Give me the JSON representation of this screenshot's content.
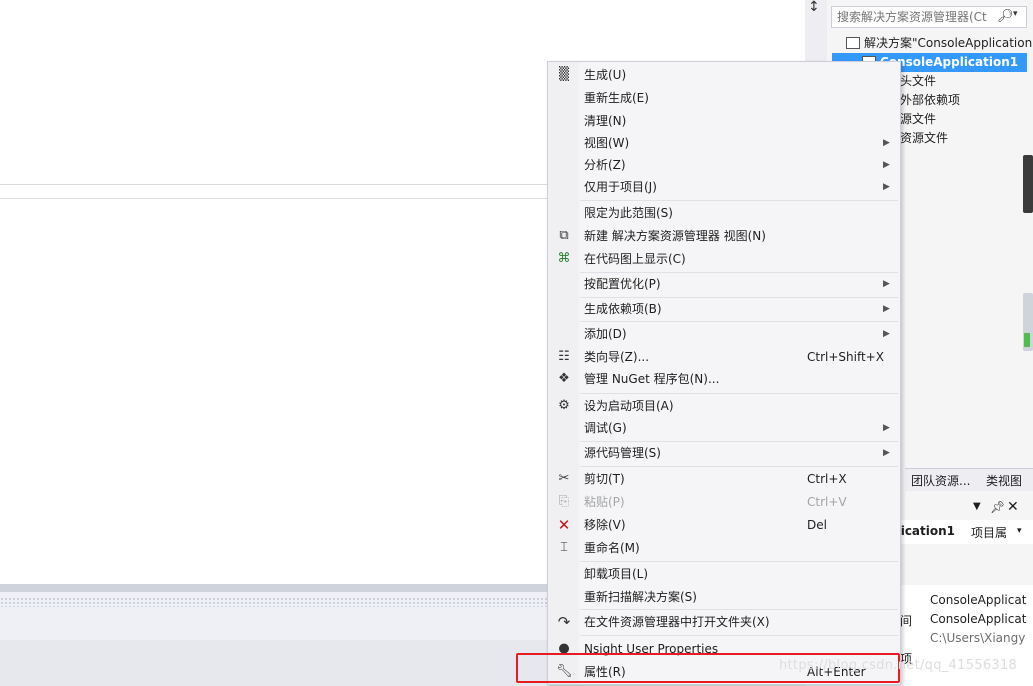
{
  "solution_explorer": {
    "search_placeholder": "搜索解决方案资源管理器(Ctr",
    "tree": [
      {
        "label": "解决方案\"ConsoleApplication",
        "selected": false
      },
      {
        "label": "ConsoleApplication1",
        "selected": true
      },
      {
        "label": "头文件",
        "selected": false
      },
      {
        "label": "外部依赖项",
        "selected": false
      },
      {
        "label": "源文件",
        "selected": false
      },
      {
        "label": "资源文件",
        "selected": false
      }
    ],
    "tabs": [
      "团队资源...",
      "类视图"
    ]
  },
  "properties_panel": {
    "title": "plication1",
    "subtitle": "项目属",
    "left_label": "间",
    "left_label2": "项",
    "values": [
      "ConsoleApplicat",
      "ConsoleApplicat",
      "C:\\Users\\Xiangy"
    ]
  },
  "context_menu": {
    "items": [
      {
        "label": "生成(U)",
        "icon": "build-icon"
      },
      {
        "label": "重新生成(E)"
      },
      {
        "label": "清理(N)"
      },
      {
        "label": "视图(W)",
        "submenu": true
      },
      {
        "label": "分析(Z)",
        "submenu": true
      },
      {
        "label": "仅用于项目(J)",
        "submenu": true
      },
      {
        "label": "限定为此范围(S)"
      },
      {
        "label": "新建 解决方案资源管理器 视图(N)",
        "icon": "new-view-icon"
      },
      {
        "label": "在代码图上显示(C)",
        "icon": "code-map-icon"
      },
      {
        "label": "按配置优化(P)",
        "submenu": true
      },
      {
        "label": "生成依赖项(B)",
        "submenu": true
      },
      {
        "label": "添加(D)",
        "submenu": true
      },
      {
        "label": "类向导(Z)...",
        "shortcut": "Ctrl+Shift+X",
        "icon": "class-wizard-icon"
      },
      {
        "label": "管理 NuGet 程序包(N)...",
        "icon": "nuget-icon"
      },
      {
        "label": "设为启动项目(A)",
        "icon": "gear-icon"
      },
      {
        "label": "调试(G)",
        "submenu": true
      },
      {
        "label": "源代码管理(S)",
        "submenu": true
      },
      {
        "label": "剪切(T)",
        "shortcut": "Ctrl+X",
        "icon": "cut-icon"
      },
      {
        "label": "粘贴(P)",
        "shortcut": "Ctrl+V",
        "icon": "paste-icon",
        "disabled": true
      },
      {
        "label": "移除(V)",
        "shortcut": "Del",
        "icon": "remove-icon"
      },
      {
        "label": "重命名(M)",
        "icon": "rename-icon"
      },
      {
        "label": "卸载项目(L)"
      },
      {
        "label": "重新扫描解决方案(S)"
      },
      {
        "label": "在文件资源管理器中打开文件夹(X)",
        "icon": "open-folder-icon"
      },
      {
        "label": "Nsight User Properties",
        "icon": "nsight-icon"
      },
      {
        "label": "属性(R)",
        "shortcut": "Alt+Enter",
        "icon": "wrench-icon"
      }
    ]
  },
  "watermark": "https://blog.csdn.net/qq_41556318",
  "colors": {
    "selection": "#3399ff",
    "highlight_box": "#e51c23",
    "remove_icon": "#c4161c"
  }
}
